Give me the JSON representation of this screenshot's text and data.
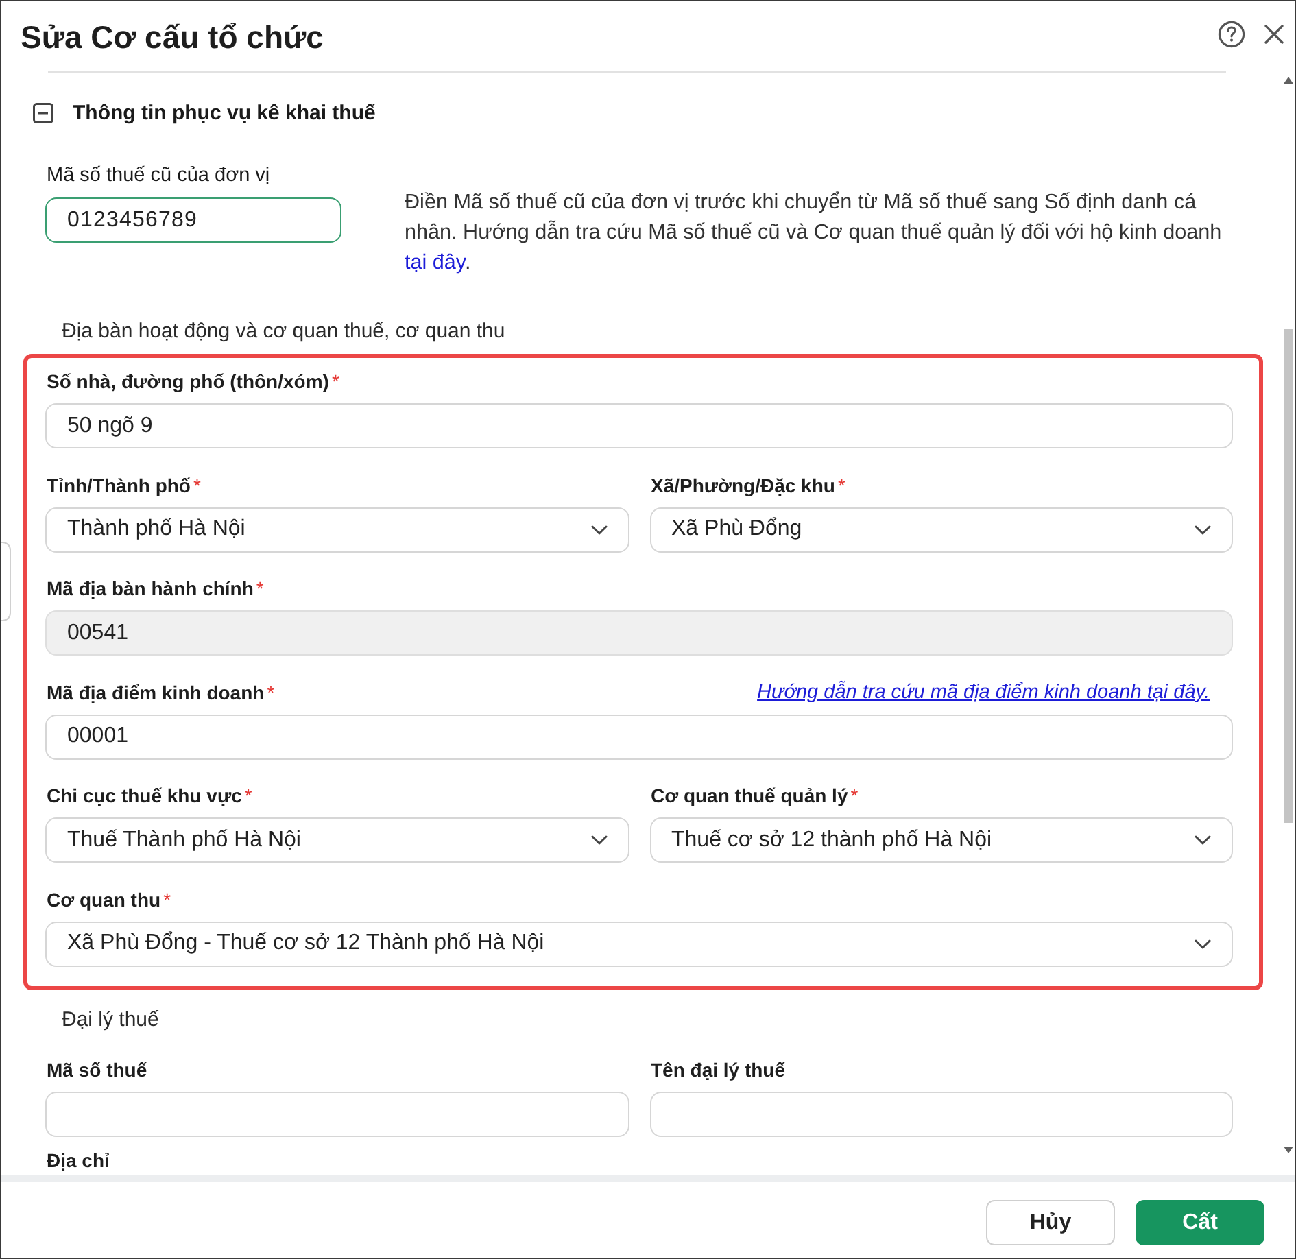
{
  "dialog": {
    "title": "Sửa Cơ cấu tổ chức"
  },
  "section": {
    "title": "Thông tin phục vụ kê khai thuế",
    "expanded": true
  },
  "old_tax_code": {
    "label": "Mã số thuế cũ của đơn vị",
    "value": "0123456789",
    "focused": true,
    "note": {
      "text": "Điền Mã số thuế cũ của đơn vị trước khi chuyển từ Mã số thuế sang Số định danh cá nhân. Hướng dẫn tra cứu Mã số thuế cũ và Cơ quan thuế quản lý đối với hộ kinh doanh",
      "link": "tại đây",
      "after": "."
    }
  },
  "location": {
    "title": "Địa bàn hoạt động và cơ quan thuế, cơ quan thu",
    "highlighted": true,
    "rows": [
      {
        "fields": [
          {
            "kind": "input",
            "label": "Số nhà, đường phố (thôn/xóm)",
            "required_mark": "*",
            "value": "50 ngõ 9",
            "disabled": false
          }
        ]
      },
      {
        "fields": [
          {
            "kind": "select",
            "label": "Tỉnh/Thành phố",
            "required_mark": "*",
            "value": "Thành phố Hà Nội",
            "disabled": false
          },
          {
            "kind": "select",
            "label": "Xã/Phường/Đặc khu",
            "required_mark": "*",
            "value": "Xã Phù Đổng",
            "disabled": false
          }
        ]
      },
      {
        "fields": [
          {
            "kind": "input",
            "label": "Mã địa bàn hành chính",
            "required_mark": "*",
            "value": "00541",
            "disabled": true
          }
        ]
      },
      {
        "fields": [
          {
            "kind": "input",
            "label": "Mã địa điểm kinh doanh",
            "required_mark": "*",
            "link": "Hướng dẫn tra cứu mã địa điểm kinh doanh tại đây.",
            "value": "00001",
            "disabled": false
          }
        ]
      },
      {
        "fields": [
          {
            "kind": "select",
            "label": "Chi cục thuế khu vực",
            "required_mark": "*",
            "value": "Thuế Thành phố Hà Nội",
            "disabled": false
          },
          {
            "kind": "select",
            "label": "Cơ quan thuế quản lý",
            "required_mark": "*",
            "value": "Thuế cơ sở 12 thành phố Hà Nội",
            "disabled": false
          }
        ]
      },
      {
        "fields": [
          {
            "kind": "select",
            "label": "Cơ quan thu",
            "required_mark": "*",
            "value": "Xã Phù Đổng - Thuế cơ sở 12 Thành phố Hà Nội",
            "disabled": false
          }
        ]
      }
    ]
  },
  "tax_agent": {
    "title": "Đại lý thuế",
    "rows": [
      {
        "fields": [
          {
            "kind": "input",
            "label": "Mã số thuế",
            "disabled": false
          },
          {
            "kind": "input",
            "label": "Tên đại lý thuế",
            "disabled": false
          }
        ]
      }
    ],
    "next_label": "Địa chỉ"
  },
  "footer": {
    "buttons": [
      {
        "label": "Hủy",
        "kind": "secondary"
      },
      {
        "label": "Cất",
        "kind": "primary"
      }
    ]
  }
}
